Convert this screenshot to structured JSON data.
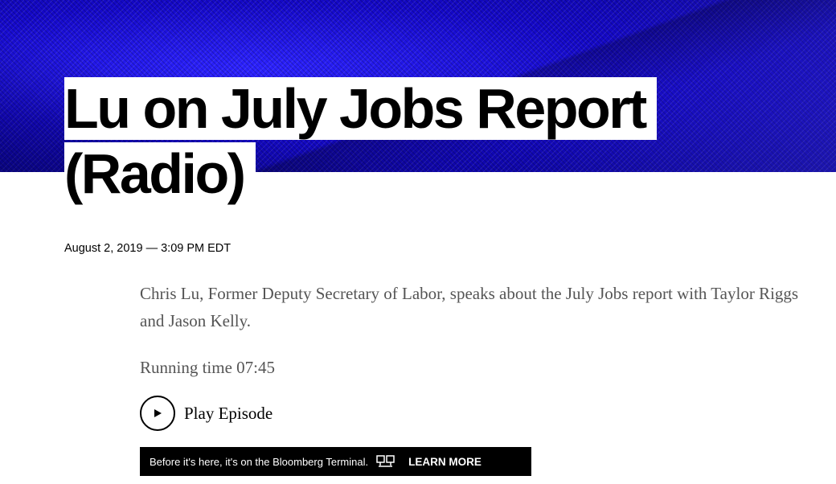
{
  "article": {
    "headline_lines": [
      "Lu on July Jobs Report",
      "(Radio)"
    ],
    "dateline": "August 2, 2019 — 3:09 PM EDT",
    "summary": "Chris Lu, Former Deputy Secretary of Labor, speaks about the July Jobs report with Taylor Riggs and Jason Kelly.",
    "running_time": "Running time 07:45"
  },
  "player": {
    "play_label": "Play Episode",
    "icon": "play-icon"
  },
  "promo": {
    "text": "Before it's here, it's on the Bloomberg Terminal.",
    "icon": "terminal-icon",
    "cta": "LEARN MORE"
  },
  "colors": {
    "hero": "#1a0fd6",
    "body_text": "#555555",
    "banner_bg": "#000000"
  }
}
